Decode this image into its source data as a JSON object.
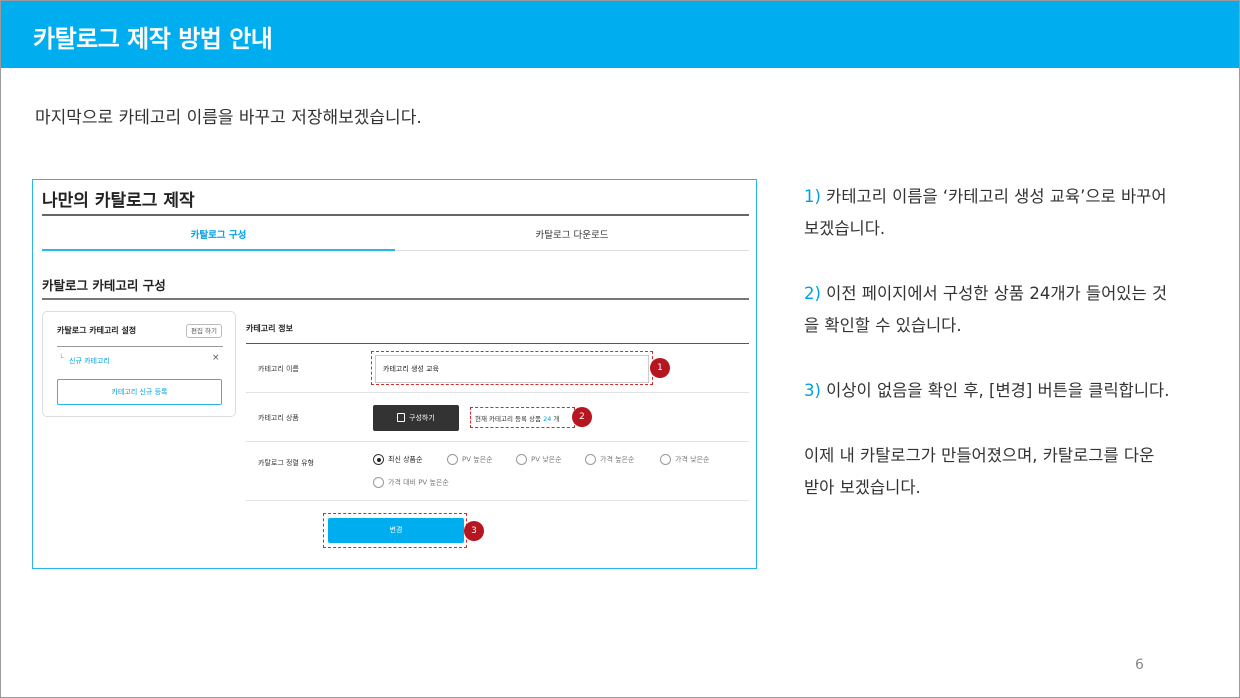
{
  "header": {
    "title": "카탈로그 제작 방법 안내"
  },
  "intro": "마지막으로 카테고리 이름을 바꾸고 저장해보겠습니다.",
  "page_number": "6",
  "screenshot": {
    "title": "나만의 카탈로그 제작",
    "tabs": [
      {
        "label": "카탈로그 구성",
        "active": true
      },
      {
        "label": "카탈로그 다운로드",
        "active": false
      }
    ],
    "section_title": "카탈로그 카테고리 구성",
    "category_box": {
      "title": "카탈로그 카테고리 설정",
      "edit_button": "편집 하기",
      "branch": "└",
      "item_label": "신규 카테고리",
      "close": "×",
      "add_button": "카테고리 신규 등록"
    },
    "info": {
      "title": "카테고리 정보",
      "name_label": "카테고리 이름",
      "name_value": "카테고리 생성 교육",
      "product_label": "카테고리 상품",
      "compose_button": "구성하기",
      "count_prefix": "현재 카테고리 등록 상품 ",
      "count_value": "24",
      "count_suffix": " 개",
      "sort_label": "카탈로그 정렬 유형",
      "sort_options": [
        "최신 상품순",
        "PV 높은순",
        "PV 낮은순",
        "가격 높은순",
        "가격 낮은순",
        "가격 대비 PV 높은순"
      ],
      "sort_selected": "최신 상품순"
    },
    "change_button": "변경",
    "badges": [
      "1",
      "2",
      "3"
    ]
  },
  "steps": [
    {
      "num": "1)",
      "text": " 카테고리 이름을 ‘카테고리 생성 교육’으로 바꾸어 보겠습니다."
    },
    {
      "num": "2)",
      "text": " 이전 페이지에서 구성한 상품 24개가 들어있는 것을 확인할 수 있습니다."
    },
    {
      "num": "3)",
      "text": " 이상이 없음을 확인 후, [변경] 버튼을 클릭합니다."
    },
    {
      "num": "",
      "text": "이제 내 카탈로그가 만들어졌으며, 카탈로그를 다운 받아 보겠습니다."
    }
  ],
  "colors": {
    "accent": "#00aeef",
    "highlight": "#d42a2a",
    "badge": "#b5161f"
  }
}
